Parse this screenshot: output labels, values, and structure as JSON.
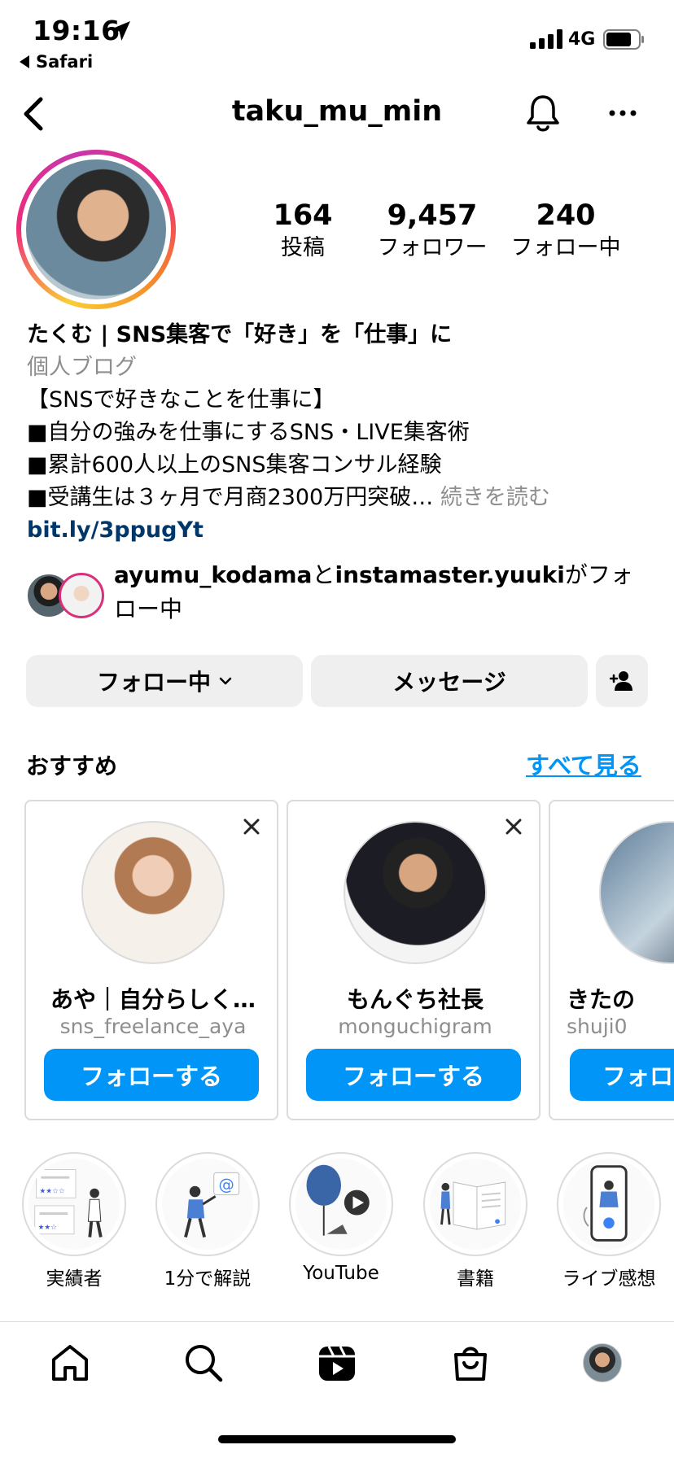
{
  "status": {
    "time": "19:16",
    "back_app": "Safari",
    "network": "4G"
  },
  "header": {
    "username": "taku_mu_min"
  },
  "stats": {
    "posts": {
      "value": "164",
      "label": "投稿"
    },
    "followers": {
      "value": "9,457",
      "label": "フォロワー"
    },
    "following": {
      "value": "240",
      "label": "フォロー中"
    }
  },
  "bio": {
    "name": "たくむ | SNS集客で「好き」を「仕事」に",
    "category": "個人ブログ",
    "lines": [
      "【SNSで好きなことを仕事に】",
      "■自分の強みを仕事にするSNS・LIVE集客術",
      "■累計600人以上のSNS集客コンサル経験",
      "■受講生は３ヶ月で月商2300万円突破…"
    ],
    "more": "続きを読む",
    "link": "bit.ly/3ppugYt"
  },
  "mutual": {
    "user1": "ayumu_kodama",
    "joiner": "と",
    "user2": "instamaster.yuuki",
    "suffix": "がフォロー中"
  },
  "actions": {
    "following": "フォロー中",
    "message": "メッセージ"
  },
  "suggested": {
    "title": "おすすめ",
    "see_all": "すべて見る",
    "cards": [
      {
        "name": "あや｜自分らしく…",
        "handle": "sns_freelance_aya",
        "button": "フォローする"
      },
      {
        "name": "もんぐち社長",
        "handle": "monguchigram",
        "button": "フォローする"
      },
      {
        "name": "きたの",
        "handle": "shuji0",
        "button": "フォロ"
      }
    ]
  },
  "highlights": [
    {
      "label": "実績者"
    },
    {
      "label": "1分で解説"
    },
    {
      "label": "YouTube"
    },
    {
      "label": "書籍"
    },
    {
      "label": "ライブ感想"
    }
  ],
  "colors": {
    "accent": "#0095f6",
    "link": "#00376b",
    "muted": "#8e8e8e",
    "button_bg": "#efefef"
  },
  "icons": [
    "location-arrow-icon",
    "signal-icon",
    "battery-icon",
    "back-chevron-icon",
    "bell-icon",
    "more-icon",
    "chevron-down-icon",
    "add-user-icon",
    "close-icon",
    "home-icon",
    "search-icon",
    "reels-icon",
    "shop-icon"
  ]
}
